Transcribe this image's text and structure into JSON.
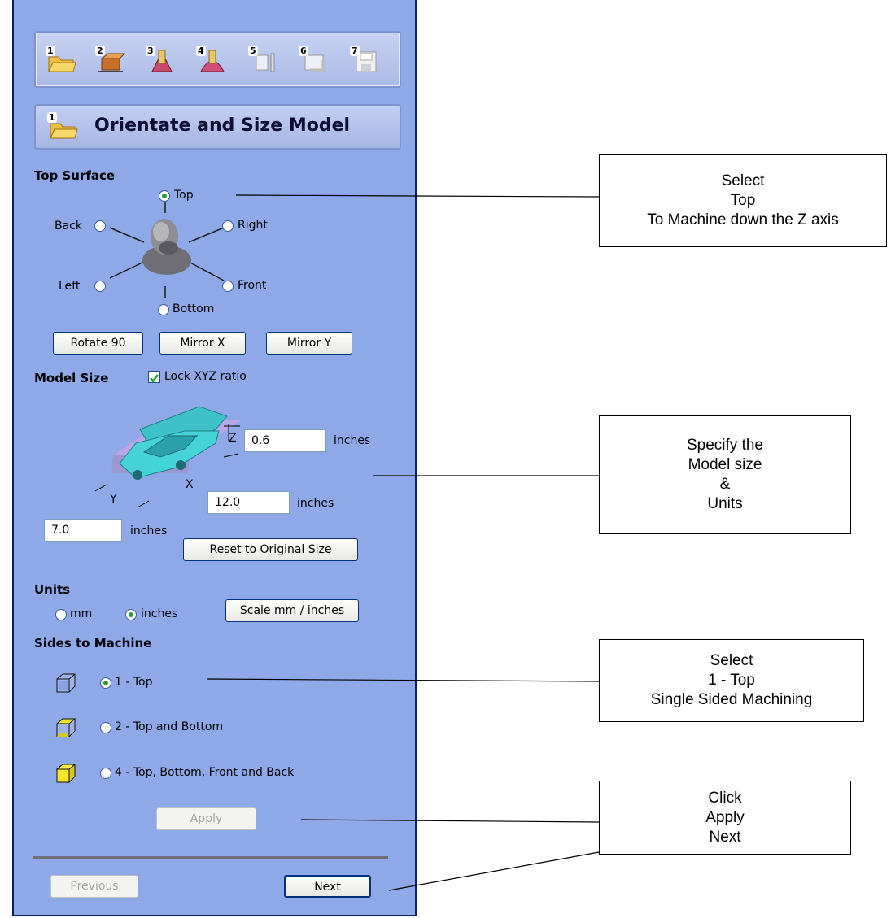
{
  "toolbar": {
    "icons": [
      {
        "num": "1",
        "icon": "open-folder-icon"
      },
      {
        "num": "2",
        "icon": "position-model-icon"
      },
      {
        "num": "3",
        "icon": "roughing-icon"
      },
      {
        "num": "4",
        "icon": "finishing-icon"
      },
      {
        "num": "5",
        "icon": "cutout-icon"
      },
      {
        "num": "6",
        "icon": "preview-icon"
      },
      {
        "num": "7",
        "icon": "save-toolpath-icon"
      }
    ]
  },
  "step": {
    "num": "1",
    "title": "Orientate and Size Model"
  },
  "top_surface": {
    "label": "Top Surface",
    "options": {
      "top": "Top",
      "back": "Back",
      "right": "Right",
      "left": "Left",
      "front": "Front",
      "bottom": "Bottom"
    },
    "selected": "top"
  },
  "buttons": {
    "rotate": "Rotate 90",
    "mirror_x": "Mirror X",
    "mirror_y": "Mirror Y",
    "reset": "Reset to Original Size",
    "scale": "Scale mm / inches",
    "apply": "Apply",
    "previous": "Previous",
    "next": "Next"
  },
  "model_size": {
    "label": "Model Size",
    "lock_label": "Lock XYZ ratio",
    "lock_checked": true,
    "z_value": "0.6",
    "x_value": "12.0",
    "y_value": "7.0",
    "unit": "inches",
    "axis_z": "Z",
    "axis_x": "X",
    "axis_y": "Y"
  },
  "units": {
    "label": "Units",
    "mm": "mm",
    "inches": "inches",
    "selected": "inches"
  },
  "sides": {
    "label": "Sides to Machine",
    "options": [
      "1 - Top",
      "2 - Top and Bottom",
      "4 - Top, Bottom, Front and Back"
    ],
    "selected": 0
  },
  "annotations": {
    "a1": [
      "Select",
      "Top",
      "To Machine down the Z axis"
    ],
    "a2": [
      "Specify the",
      "Model size",
      "&",
      "Units"
    ],
    "a3": [
      "Select",
      "1 - Top",
      "Single Sided Machining"
    ],
    "a4": [
      "Click",
      "Apply",
      "Next"
    ]
  },
  "colors": {
    "panel_bg": "#8ea8e8",
    "radio_selected": "#2d9a36",
    "model_cyan": "#3ec1c8"
  }
}
